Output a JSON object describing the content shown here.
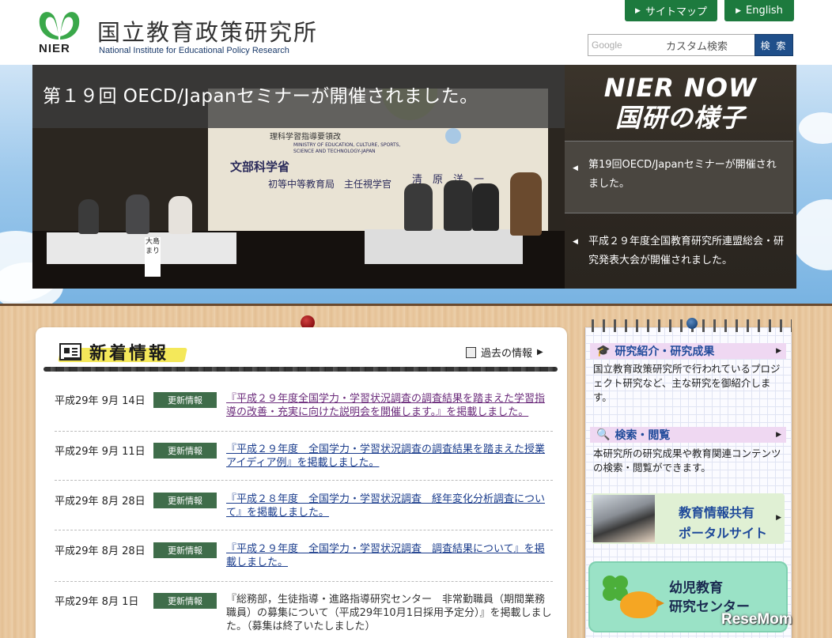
{
  "header": {
    "logo_abbr": "NIER",
    "org_name_ja": "国立教育政策研究所",
    "org_name_en": "National Institute for Educational Policy Research",
    "sitemap_label": "サイトマップ",
    "english_label": "English",
    "search_brand": "Google",
    "search_placeholder": "カスタム検索",
    "search_button": "検 索"
  },
  "hero": {
    "caption": "第１９回 OECD/Japanセミナーが開催されました。",
    "screen_text_1": "文部科学省",
    "screen_text_2": "MINISTRY OF EDUCATION, CULTURE, SPORTS, SCIENCE AND TECHNOLOGY-JAPAN",
    "screen_text_3": "初等中等教育局　主任視学官",
    "screen_text_4": "清　原　洋　一",
    "screen_text_5": "理科学習指導要領改",
    "nameplate": "大島 まり"
  },
  "now": {
    "title_line1": "NIER NOW",
    "title_line2": "国研の様子",
    "items": [
      {
        "text": "第19回OECD/Japanセミナーが開催されました。"
      },
      {
        "text": "平成２９年度全国教育研究所連盟総会・研究発表大会が開催されました。"
      }
    ]
  },
  "news": {
    "title": "新着情報",
    "past_label": "過去の情報",
    "rows": [
      {
        "date": "平成29年 9月 14日",
        "badge": "更新情報",
        "text": "『平成２９年度全国学力・学習状況調査の調査結果を踏まえた学習指導の改善・充実に向けた説明会を開催します。』を掲載しました。"
      },
      {
        "date": "平成29年 9月 11日",
        "badge": "更新情報",
        "text": "『平成２９年度　全国学力・学習状況調査の調査結果を踏まえた授業アイディア例』を掲載しました。"
      },
      {
        "date": "平成29年 8月 28日",
        "badge": "更新情報",
        "text": "『平成２８年度　全国学力・学習状況調査　経年変化分析調査について』を掲載しました。"
      },
      {
        "date": "平成29年 8月 28日",
        "badge": "更新情報",
        "text": "『平成２９年度　全国学力・学習状況調査　調査結果について』を掲載しました。"
      },
      {
        "date": "平成29年 8月 1日",
        "badge": "更新情報",
        "text": "『総務部，生徒指導・進路指導研究センター　非常勤職員（期間業務職員）の募集について（平成29年10月1日採用予定分）』を掲載しました。（募集は終了いたしました）"
      }
    ]
  },
  "side": {
    "research_head": "研究紹介・研究成果",
    "research_body": "国立教育政策研究所で行われているプロジェクト研究など、主な研究を御紹介します。",
    "search_head": "検索・閲覧",
    "search_body": "本研究所の研究成果や教育関連コンテンツの検索・閲覧ができます。",
    "portal_line1": "教育情報共有",
    "portal_line2": "ポータルサイト",
    "kinder_line1": "幼児教育",
    "kinder_line2": "研究センター"
  },
  "watermark": "ReseMom",
  "colors": {
    "header_green": "#1d7a3e",
    "search_blue": "#1f4f8a",
    "badge_green": "#3f6d4a",
    "link_blue": "#1a3c8c"
  }
}
